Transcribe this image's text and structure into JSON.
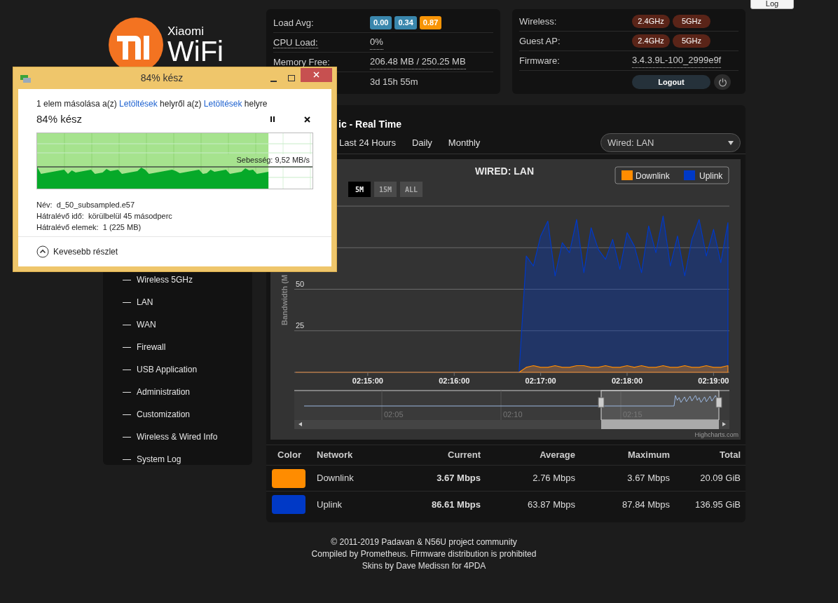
{
  "top_button": "Log",
  "logo": {
    "brand": "Xiaomi",
    "product": "WiFi"
  },
  "sysinfo": [
    {
      "kind": "badges",
      "label": "Load Avg:",
      "badges": [
        {
          "text": "0.00",
          "color": "#3a87ad"
        },
        {
          "text": "0.34",
          "color": "#3a87ad"
        },
        {
          "text": "0.87",
          "color": "#f89406"
        }
      ]
    },
    {
      "kind": "value",
      "label": "CPU Load:",
      "value": "0%"
    },
    {
      "kind": "value",
      "label": "Memory Free:",
      "value": "206.48 MB / 250.25 MB"
    },
    {
      "kind": "value",
      "value": "3d 15h 55m"
    }
  ],
  "status": [
    {
      "kind": "badges",
      "label": "Wireless:",
      "badges": [
        "2.4GHz",
        "5GHz"
      ]
    },
    {
      "kind": "badges",
      "label": "Guest AP:",
      "badges": [
        "2.4GHz",
        "5GHz"
      ]
    },
    {
      "kind": "value",
      "label": "Firmware:",
      "value": "3.4.3.9L-100_2999e9f"
    },
    {
      "kind": "logout",
      "button": "Logout"
    }
  ],
  "sidebar": {
    "items": [
      {
        "label": "Wireless 5GHz",
        "selected": false
      },
      {
        "label": "LAN",
        "selected": false
      },
      {
        "label": "WAN",
        "selected": false
      },
      {
        "label": "Firewall",
        "selected": false
      },
      {
        "label": "USB Application",
        "selected": false
      },
      {
        "label": "Administration",
        "selected": false
      },
      {
        "label": "Customization",
        "selected": false
      },
      {
        "label": "Wireless & Wired Info",
        "selected": false
      },
      {
        "label": "System Log",
        "selected": false
      }
    ]
  },
  "main": {
    "title": "ic - Real Time",
    "tabs": [
      {
        "label": "Last 24 Hours",
        "selected": false
      },
      {
        "label": "Daily",
        "selected": false
      },
      {
        "label": "Monthly",
        "selected": false
      }
    ],
    "select": {
      "value": "Wired: LAN"
    },
    "chart": {
      "range_buttons": [
        {
          "label": "5M",
          "selected": true
        },
        {
          "label": "15M",
          "selected": false
        },
        {
          "label": "ALL",
          "selected": false
        }
      ],
      "navigator_labels": [
        "02:05",
        "02:10",
        "02:15"
      ],
      "credit": "Highcharts.com",
      "chart_data": {
        "type": "area",
        "title": "WIRED: LAN",
        "ylabel": "Bandwidth (M",
        "categories": [
          null,
          null,
          null,
          null,
          null,
          null,
          null,
          null,
          null,
          null,
          "02:15:00",
          null,
          null,
          null,
          null,
          null,
          null,
          null,
          null,
          null,
          null,
          null,
          "02:16:00",
          null,
          null,
          null,
          null,
          null,
          null,
          null,
          null,
          null,
          null,
          null,
          "02:17:00",
          null,
          null,
          null,
          null,
          null,
          null,
          null,
          null,
          null,
          null,
          null,
          "02:18:00",
          null,
          null,
          null,
          null,
          null,
          null,
          null,
          null,
          null,
          null,
          null,
          "02:19:00",
          null,
          null
        ],
        "series": [
          {
            "name": "Downlink",
            "color": "#ff8c00",
            "values": [
              0,
              0,
              0,
              0,
              0,
              0,
              0,
              0,
              0,
              0,
              0,
              0,
              0,
              0,
              0,
              0,
              0,
              0,
              0,
              0,
              0,
              0,
              0,
              0,
              0,
              0,
              0,
              0,
              0,
              0,
              0,
              0,
              3,
              4,
              3,
              3,
              4,
              3,
              3,
              4,
              4,
              3,
              3,
              4,
              3,
              3,
              4,
              3,
              4,
              3,
              3,
              4,
              3,
              3,
              4,
              3,
              3,
              4,
              3,
              3,
              4
            ]
          },
          {
            "name": "Uplink",
            "color": "#0039c6",
            "values": [
              0,
              0,
              0,
              0,
              0,
              0,
              0,
              0,
              0,
              0,
              0,
              0,
              0,
              0,
              0,
              0,
              0,
              0,
              0,
              0,
              0,
              0,
              0,
              0,
              0,
              0,
              0,
              0,
              0,
              0,
              0,
              0,
              70,
              64,
              82,
              91,
              58,
              78,
              72,
              92,
              60,
              87,
              74,
              68,
              80,
              62,
              84,
              76,
              60,
              88,
              72,
              94,
              64,
              82,
              58,
              80,
              92,
              70,
              86,
              66,
              90
            ]
          }
        ],
        "ylim": [
          0,
          100
        ],
        "legend": "top-right",
        "yticks": [
          25,
          50
        ]
      }
    },
    "table": {
      "columns": [
        "Color",
        "Network",
        "Current",
        "Average",
        "Maximum",
        "Total"
      ],
      "rows": [
        {
          "color": "#ff8c00",
          "network": "Downlink",
          "current": "3.67 Mbps",
          "average": "2.76 Mbps",
          "maximum": "3.67 Mbps",
          "total": "20.09 GiB"
        },
        {
          "color": "#0039c6",
          "network": "Uplink",
          "current": "86.61 Mbps",
          "average": "63.87 Mbps",
          "maximum": "87.84 Mbps",
          "total": "136.95 GiB"
        }
      ]
    }
  },
  "footer": [
    "© 2011-2019 Padavan & N56U project community",
    "Compiled by Prometheus. Firmware distribution is prohibited",
    "Skins by Dave Medissn for 4PDA"
  ],
  "dialog": {
    "title": "84% kész",
    "description": [
      {
        "kind": "text",
        "text": "1 elem másolása a(z) "
      },
      {
        "kind": "link",
        "text": "Letöltések"
      },
      {
        "kind": "text",
        "text": " helyről a(z) "
      },
      {
        "kind": "link",
        "text": "Letöltések"
      },
      {
        "kind": "text",
        "text": " helyre"
      }
    ],
    "status": "84% kész",
    "progress": {
      "level": 0.84
    },
    "speed": "Sebesség: 9,52 MB/s",
    "details": [
      "Név:  d_50_subsampled.e57",
      "Hátralévő idő:  körülbelül 45 másodperc",
      "Hátralévő elemek:  1 (225 MB)"
    ],
    "toggle": "Kevesebb részlet"
  }
}
